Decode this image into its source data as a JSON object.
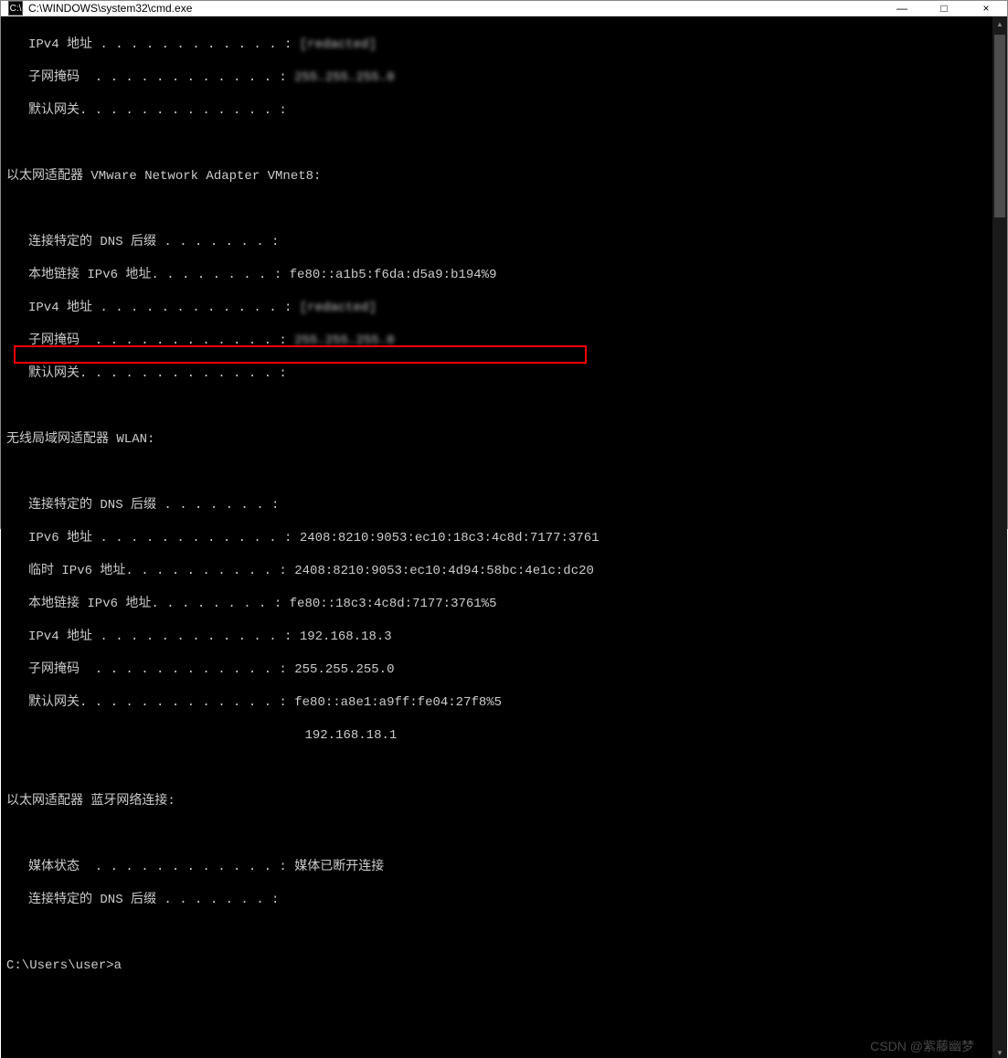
{
  "titlebar": {
    "icon_label": "C:\\",
    "title": "C:\\WINDOWS\\system32\\cmd.exe",
    "minimize": "—",
    "maximize": "□",
    "close": "×"
  },
  "watermark": "CSDN @紫藤幽梦",
  "terminal": {
    "block1": {
      "ipv4_label": "IPv4 地址 . . . . . . . . . . . . : ",
      "ipv4_value_blurred": "[redacted]",
      "subnet_label": "子网掩码  . . . . . . . . . . . . : ",
      "subnet_value_blurred": "255.255.255.0",
      "gateway_label": "默认网关. . . . . . . . . . . . . :"
    },
    "adapter2": {
      "header": "以太网适配器 VMware Network Adapter VMnet8:",
      "dns_suffix": "连接特定的 DNS 后缀 . . . . . . . :",
      "link_local_ipv6_label": "本地链接 IPv6 地址. . . . . . . . : ",
      "link_local_ipv6_value": "fe80::a1b5:f6da:d5a9:b194%9",
      "ipv4_label": "IPv4 地址 . . . . . . . . . . . . : ",
      "ipv4_value_blurred": "[redacted]",
      "subnet_label": "子网掩码  . . . . . . . . . . . . : ",
      "subnet_value_blurred": "255.255.255.0",
      "gateway_label": "默认网关. . . . . . . . . . . . . :"
    },
    "adapter3": {
      "header": "无线局域网适配器 WLAN:",
      "dns_suffix": "连接特定的 DNS 后缀 . . . . . . . :",
      "ipv6_label": "IPv6 地址 . . . . . . . . . . . . : ",
      "ipv6_value": "2408:8210:9053:ec10:18c3:4c8d:7177:3761",
      "temp_ipv6_label": "临时 IPv6 地址. . . . . . . . . . : ",
      "temp_ipv6_value": "2408:8210:9053:ec10:4d94:58bc:4e1c:dc20",
      "link_local_ipv6_label": "本地链接 IPv6 地址. . . . . . . . : ",
      "link_local_ipv6_value": "fe80::18c3:4c8d:7177:3761%5",
      "ipv4_label": "IPv4 地址 . . . . . . . . . . . . : ",
      "ipv4_value": "192.168.18.3",
      "subnet_label": "子网掩码  . . . . . . . . . . . . : ",
      "subnet_value": "255.255.255.0",
      "gateway_label": "默认网关. . . . . . . . . . . . . : ",
      "gateway_value1": "fe80::a8e1:a9ff:fe04:27f8%5",
      "gateway_value2_indent": "                                    ",
      "gateway_value2": "192.168.18.1"
    },
    "adapter4": {
      "header": "以太网适配器 蓝牙网络连接:",
      "media_state_label": "媒体状态  . . . . . . . . . . . . : ",
      "media_state_value": "媒体已断开连接",
      "dns_suffix": "连接特定的 DNS 后缀 . . . . . . . :"
    },
    "prompt": {
      "path": "C:\\Users\\user>",
      "input": "a"
    }
  }
}
